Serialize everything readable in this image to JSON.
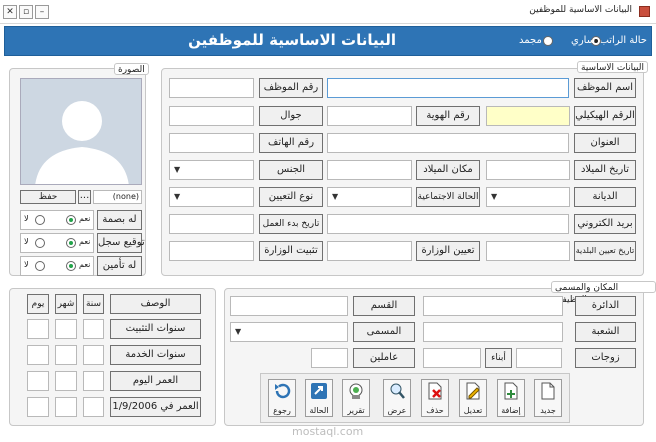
{
  "window": {
    "title": "البيانات الاساسية للموظفين"
  },
  "header": {
    "title": "البيانات الاساسية للموظفين",
    "status_label": "حالة الراتب",
    "option_active": "ساري",
    "option_frozen": "مجمد"
  },
  "photo": {
    "legend": "الصورة",
    "save_button": "حفظ",
    "browse_button": "...",
    "path_value": "(none)"
  },
  "flags": {
    "fingerprint": "له بصمة",
    "signature": "توقيع سجل",
    "insurance": "له تأمين",
    "yes": "نعم",
    "no": "لا"
  },
  "basic": {
    "legend": "البيانات الاساسية",
    "employee_name": "اسم الموظف",
    "employee_no": "رقم الموظف",
    "structural_no": "الرقم الهيكيلي",
    "id_no": "رقم الهوية",
    "mobile": "جوال",
    "address": "العنوان",
    "phone": "رقم الهاتف",
    "birth_date": "تاريخ الميلاد",
    "birth_place": "مكان الميلاد",
    "gender": "الجنس",
    "religion": "الديانة",
    "marital": "الحالة الاجتماعية",
    "appointment_type": "نوع التعيين",
    "email": "بريد الكتروني",
    "work_start": "تاريخ بدء العمل",
    "municipal_date": "تاريخ تعيين البلدية",
    "ministry_appoint": "تعيين الوزارة",
    "ministry_confirm": "تثبيت الوزارة"
  },
  "place": {
    "legend": "المكان والمسمى الوظيفي",
    "department": "الدائرة",
    "section": "القسم",
    "division": "الشعبة",
    "title": "المسمى",
    "spouses": "زوجات",
    "children": "أبناء",
    "dependents": "عاملين"
  },
  "summary": {
    "description": "الوصف",
    "year": "سنة",
    "month": "شهر",
    "day": "يوم",
    "tenure_years": "سنوات التثبيت",
    "service_years": "سنوات الخدمة",
    "age_today": "العمر اليوم",
    "age_on_date": "العمر في 1/9/2006"
  },
  "toolbar": {
    "new": "جديد",
    "add": "إضافة",
    "edit": "تعديل",
    "delete": "حذف",
    "view": "عرض",
    "report": "تقرير",
    "status": "الحالة",
    "back": "رجوع"
  },
  "watermark": "mostaql.com",
  "colors": {
    "header": "#2e74b5",
    "radio_yes": "#22a34a",
    "highlight_field": "#ffffc8"
  }
}
